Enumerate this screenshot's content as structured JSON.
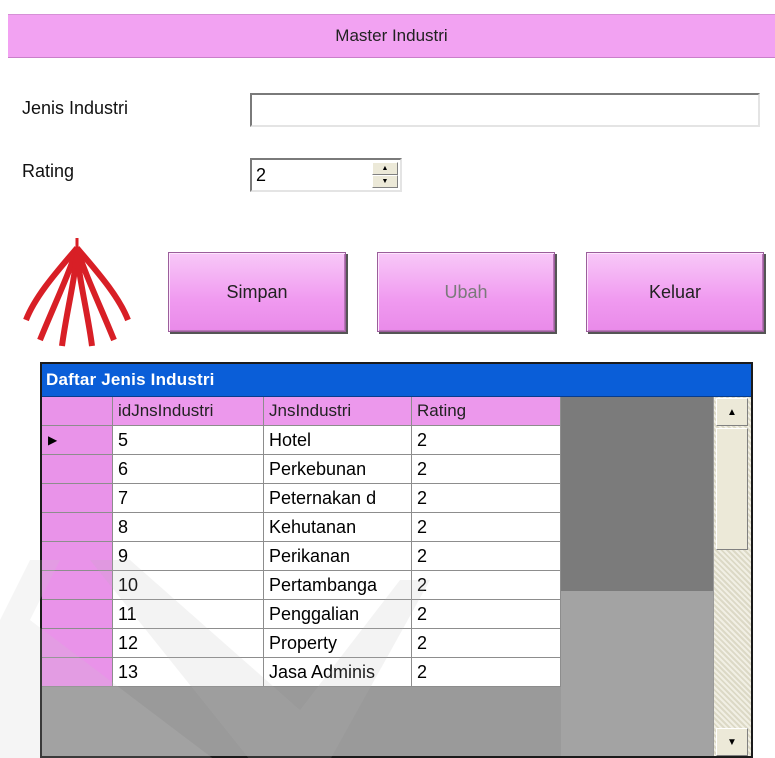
{
  "window": {
    "title": "Master Industri"
  },
  "form": {
    "jenis_label": "Jenis Industri",
    "jenis_value": "",
    "rating_label": "Rating",
    "rating_value": "2"
  },
  "buttons": {
    "simpan": "Simpan",
    "ubah": "Ubah",
    "keluar": "Keluar"
  },
  "grid": {
    "caption": "Daftar Jenis Industri",
    "columns": [
      "idJnsIndustri",
      "JnsIndustri",
      "Rating"
    ],
    "rows": [
      {
        "sel": "▶",
        "id": "5",
        "jns": "Hotel",
        "rating": "2"
      },
      {
        "sel": "",
        "id": "6",
        "jns": "Perkebunan",
        "rating": "2"
      },
      {
        "sel": "",
        "id": "7",
        "jns": "Peternakan d",
        "rating": "2"
      },
      {
        "sel": "",
        "id": "8",
        "jns": "Kehutanan",
        "rating": "2"
      },
      {
        "sel": "",
        "id": "9",
        "jns": "Perikanan",
        "rating": "2"
      },
      {
        "sel": "",
        "id": "10",
        "jns": "Pertambanga",
        "rating": "2"
      },
      {
        "sel": "",
        "id": "11",
        "jns": "Penggalian",
        "rating": "2"
      },
      {
        "sel": "",
        "id": "12",
        "jns": "Property",
        "rating": "2"
      },
      {
        "sel": "",
        "id": "13",
        "jns": "Jasa Adminis",
        "rating": "2"
      }
    ]
  },
  "icons": {
    "logo": "red-arc-logo-icon",
    "spin_up": "triangle-up-icon",
    "spin_down": "triangle-down-icon",
    "scroll_up": "scroll-up-arrow-icon",
    "scroll_down": "scroll-down-arrow-icon",
    "row_indicator": "current-row-arrow-icon"
  },
  "colors": {
    "accent_pink": "#f2a2f2",
    "caption_blue": "#0a5ed8",
    "logo_red": "#d81f26"
  }
}
